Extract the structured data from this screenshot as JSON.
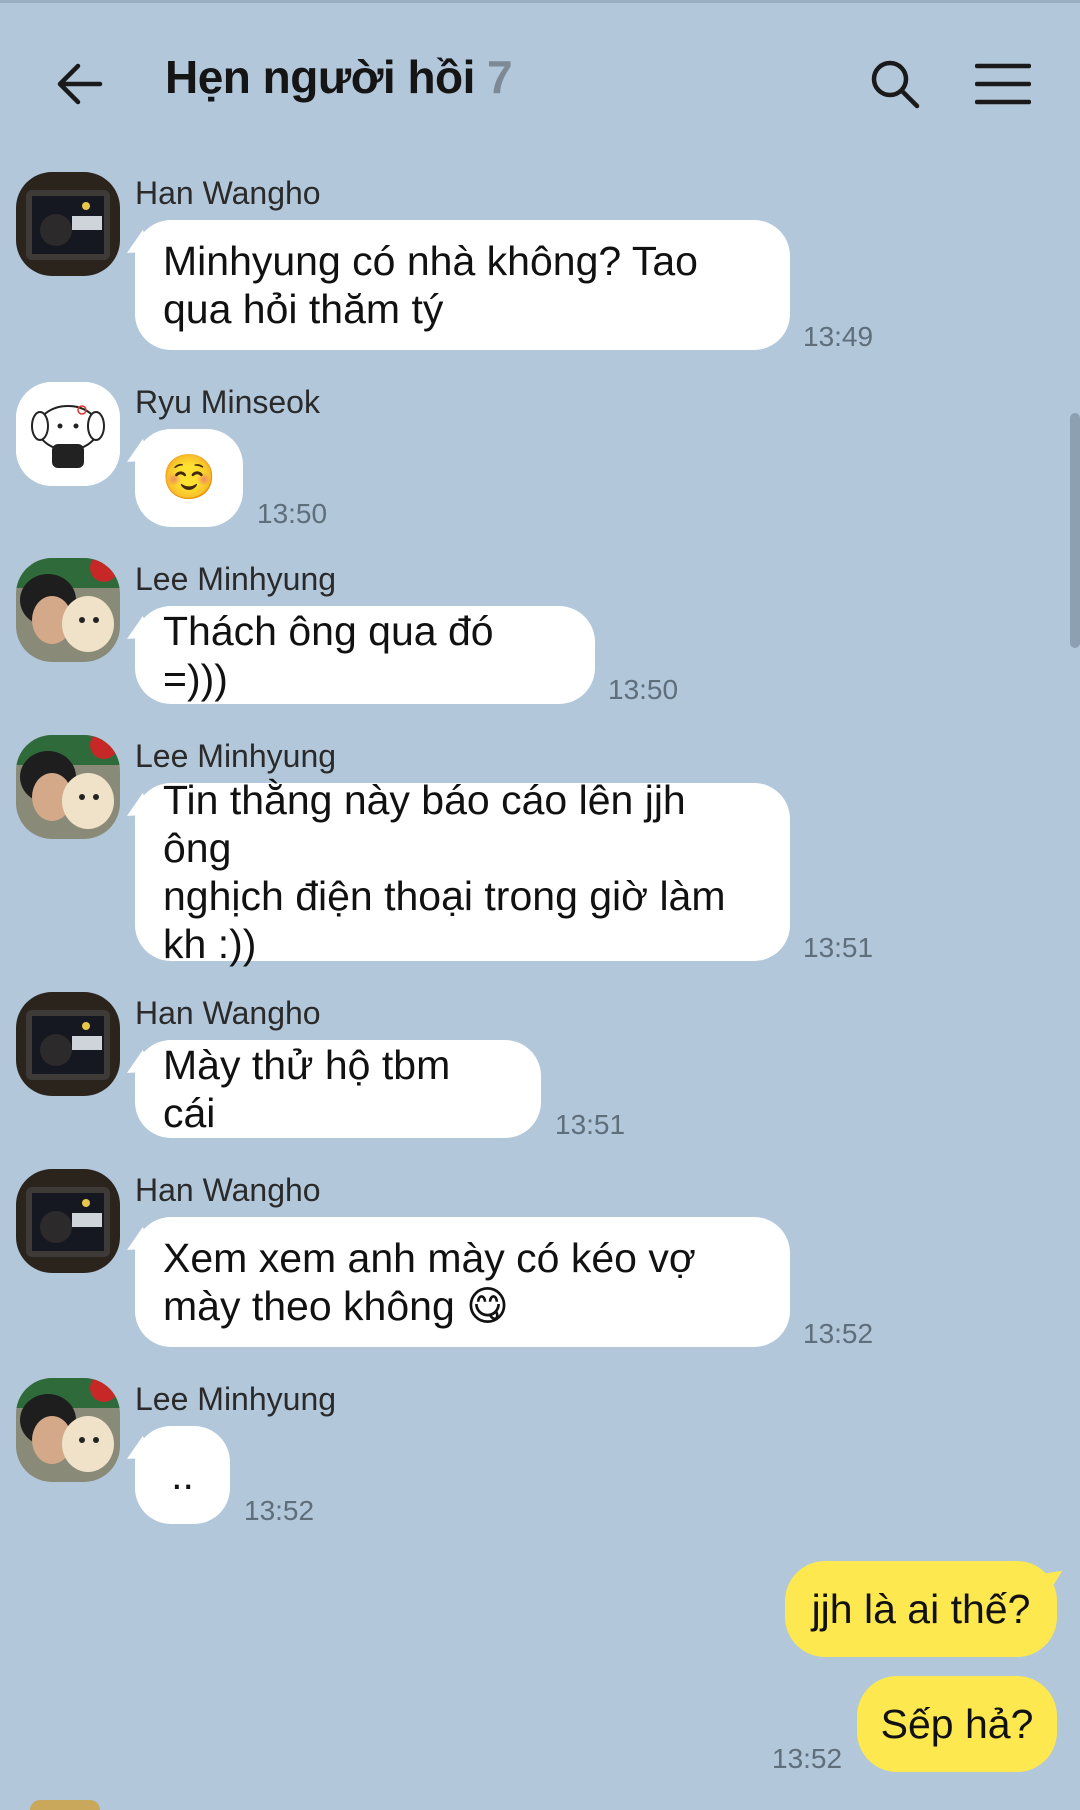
{
  "header": {
    "title": "Hẹn người hồi",
    "member_count": "7",
    "back_icon": "back-arrow-icon",
    "search_icon": "search-icon",
    "menu_icon": "hamburger-menu-icon"
  },
  "messages": [
    {
      "sender": "Han Wangho",
      "text": "Minhyung có nhà không? Tao\nqua hỏi thăm tý",
      "time": "13:49"
    },
    {
      "sender": "Ryu Minseok",
      "text": "☺️",
      "time": "13:50"
    },
    {
      "sender": "Lee Minhyung",
      "text": "Thách ông qua đó =)))",
      "time": "13:50"
    },
    {
      "sender": "Lee Minhyung",
      "text": "Tin thằng này báo cáo lên jjh ông\nnghịch điện thoại trong giờ làm\nkh :))",
      "time": "13:51"
    },
    {
      "sender": "Han Wangho",
      "text": "Mày thử hộ tbm cái",
      "time": "13:51"
    },
    {
      "sender": "Han Wangho",
      "text": "Xem xem anh mày có kéo vợ\nmày theo không 😋",
      "time": "13:52"
    },
    {
      "sender": "Lee Minhyung",
      "text": "..",
      "time": "13:52"
    }
  ],
  "my_messages": [
    {
      "text": "jjh là ai thế?"
    },
    {
      "text": "Sếp hả?",
      "time": "13:52"
    }
  ],
  "colors": {
    "background": "#b2c7da",
    "incoming_bubble": "#ffffff",
    "outgoing_bubble": "#fde94f"
  }
}
